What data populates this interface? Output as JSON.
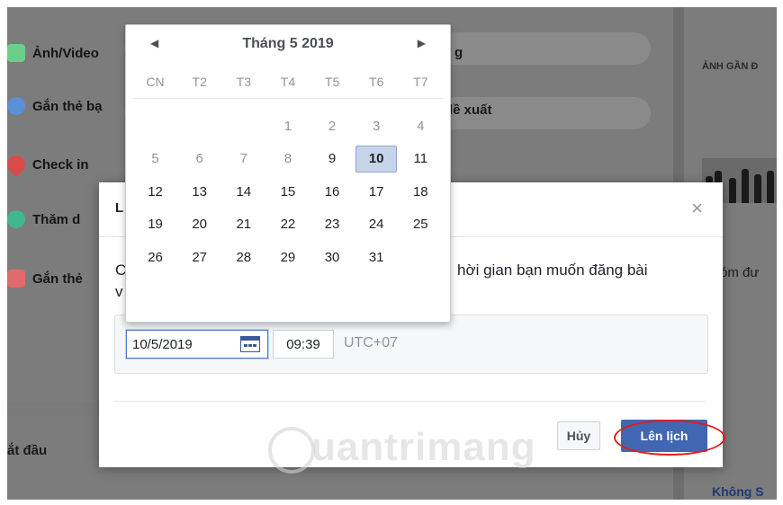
{
  "background": {
    "left_items": [
      {
        "label": "Ảnh/Video",
        "icon": "photo-icon",
        "color": "#6bcf8a"
      },
      {
        "label": "Gắn thẻ bạ",
        "icon": "tag-people-icon",
        "color": "#5b8fd8"
      },
      {
        "label": "Check in",
        "icon": "location-pin-icon",
        "color": "#d94b4b"
      },
      {
        "label": "Thăm d",
        "icon": "poll-icon",
        "color": "#3fb88d"
      },
      {
        "label": "Gắn thẻ",
        "icon": "tag-event-icon",
        "color": "#e06b6b"
      }
    ],
    "fragment_1": "g",
    "fragment_2": "lề xuất",
    "right_header": "ẢNH GẦN Đ",
    "right_fragment": "óm đư",
    "bottom_left": "ắt đầu",
    "bottom_right": "Không S"
  },
  "dialog": {
    "title": "L",
    "close": "×",
    "desc_left_1": "C",
    "desc_left_2": "v",
    "desc_right": "hời gian bạn muốn đăng bài",
    "date_value": "10/5/2019",
    "time_value": "09:39",
    "timezone": "UTC+07",
    "cancel_label": "Hủy",
    "schedule_label": "Lên lịch"
  },
  "calendar": {
    "month_label": "Tháng 5 2019",
    "prev": "◀",
    "next": "▶",
    "weekdays": [
      "CN",
      "T2",
      "T3",
      "T4",
      "T5",
      "T6",
      "T7"
    ],
    "weeks": [
      [
        "",
        "",
        "",
        "1",
        "2",
        "3",
        "4"
      ],
      [
        "5",
        "6",
        "7",
        "8",
        "9",
        "10",
        "11"
      ],
      [
        "12",
        "13",
        "14",
        "15",
        "16",
        "17",
        "18"
      ],
      [
        "19",
        "20",
        "21",
        "22",
        "23",
        "24",
        "25"
      ],
      [
        "26",
        "27",
        "28",
        "29",
        "30",
        "31",
        ""
      ]
    ],
    "selected_day": "10",
    "past_days": [
      "1",
      "2",
      "3",
      "4",
      "5",
      "6",
      "7",
      "8"
    ]
  },
  "watermark": "uantrimang"
}
